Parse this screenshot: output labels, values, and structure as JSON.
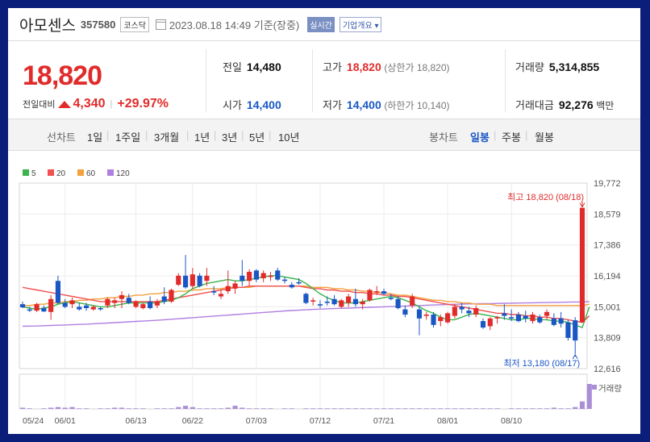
{
  "header": {
    "name": "아모센스",
    "code": "357580",
    "market": "코스닥",
    "datetime": "2023.08.18 14:49 기준(장중)",
    "realtime": "실시간",
    "overview": "기업개요"
  },
  "quote": {
    "price": "18,820",
    "change_label": "전일대비",
    "change": "4,340",
    "change_pct": "+29.97%",
    "prev_label": "전일",
    "prev": "14,480",
    "high_label": "고가",
    "high": "18,820",
    "upper_label": "(상한가 18,820)",
    "volume_label": "거래량",
    "volume": "5,314,855",
    "open_label": "시가",
    "open": "14,400",
    "low_label": "저가",
    "low": "14,400",
    "lower_label": "(하한가 10,140)",
    "amount_label": "거래대금",
    "amount": "92,276",
    "amount_unit": "백만"
  },
  "tabs": {
    "line_label": "선차트",
    "line": [
      "1일",
      "1주일",
      "3개월",
      "1년",
      "3년",
      "5년",
      "10년"
    ],
    "candle_label": "봉차트",
    "candle": [
      "일봉",
      "주봉",
      "월봉"
    ],
    "candle_selected": "일봉"
  },
  "colors": {
    "up": "#e12b2b",
    "down": "#1a57c4",
    "ma5": "#3cb44b",
    "ma20": "#f0504f",
    "ma60": "#f4a03c",
    "ma120": "#b07fe0",
    "volume": "#a98fd6"
  },
  "chart_data": {
    "type": "candlestick",
    "legend": [
      "5",
      "20",
      "60",
      "120"
    ],
    "y_ticks": [
      "19,772",
      "18,579",
      "17,386",
      "16,194",
      "15,001",
      "13,809",
      "12,616"
    ],
    "ylim": [
      12616,
      19772
    ],
    "x_ticks": [
      "05/24",
      "06/01",
      "06/13",
      "06/22",
      "07/03",
      "07/12",
      "07/21",
      "08/01",
      "08/10"
    ],
    "max_label": "최고 18,820 (08/18)",
    "min_label": "최저 13,180 (08/17)",
    "volume_label": "거래량",
    "candles": [
      [
        15100,
        15200,
        14950,
        14980
      ],
      [
        14900,
        15000,
        14800,
        14850
      ],
      [
        14850,
        15150,
        14800,
        15100
      ],
      [
        14950,
        15050,
        14800,
        14820
      ],
      [
        14800,
        15450,
        14500,
        15300
      ],
      [
        16000,
        16200,
        15100,
        15150
      ],
      [
        15150,
        15300,
        14950,
        15000
      ],
      [
        15100,
        15350,
        14950,
        15250
      ],
      [
        15000,
        15150,
        14850,
        14900
      ],
      [
        15050,
        15150,
        14850,
        14950
      ],
      [
        14900,
        15050,
        14850,
        15000
      ],
      [
        14950,
        15000,
        14850,
        14900
      ],
      [
        15050,
        15350,
        14950,
        15300
      ],
      [
        15150,
        15350,
        14950,
        15250
      ],
      [
        15300,
        15600,
        14950,
        15450
      ],
      [
        15350,
        15500,
        15100,
        15150
      ],
      [
        15000,
        15250,
        14950,
        15200
      ],
      [
        14950,
        15150,
        14900,
        15100
      ],
      [
        15200,
        15400,
        14900,
        14950
      ],
      [
        15050,
        15300,
        14950,
        15200
      ],
      [
        15400,
        15750,
        15100,
        15200
      ],
      [
        15200,
        15700,
        15150,
        15650
      ],
      [
        15850,
        16300,
        15800,
        16200
      ],
      [
        16200,
        17000,
        15700,
        15750
      ],
      [
        15800,
        16500,
        15700,
        16250
      ],
      [
        16200,
        16300,
        15750,
        15800
      ],
      [
        16000,
        16500,
        15800,
        16200
      ],
      [
        15600,
        15800,
        15450,
        15550
      ],
      [
        15400,
        15650,
        15300,
        15500
      ],
      [
        15600,
        16400,
        15500,
        15800
      ],
      [
        15700,
        16000,
        15500,
        15900
      ],
      [
        16200,
        16800,
        15800,
        16000
      ],
      [
        16000,
        16450,
        15800,
        16350
      ],
      [
        16400,
        16450,
        15950,
        16050
      ],
      [
        16100,
        16400,
        15950,
        16300
      ],
      [
        16150,
        16350,
        16000,
        16200
      ],
      [
        16400,
        16500,
        16000,
        16050
      ],
      [
        16050,
        16150,
        15900,
        16000
      ],
      [
        15850,
        15950,
        15700,
        15750
      ],
      [
        15950,
        16100,
        15850,
        15900
      ],
      [
        15500,
        15550,
        15100,
        15150
      ],
      [
        15200,
        15350,
        15050,
        15250
      ],
      [
        15100,
        15250,
        14950,
        15050
      ],
      [
        15200,
        15400,
        15050,
        15150
      ],
      [
        15300,
        15450,
        15050,
        15100
      ],
      [
        15000,
        15300,
        14950,
        15250
      ],
      [
        15150,
        15500,
        15000,
        15400
      ],
      [
        15300,
        15700,
        15000,
        15100
      ],
      [
        15100,
        15300,
        14900,
        15200
      ],
      [
        15250,
        15700,
        15200,
        15650
      ],
      [
        15550,
        15800,
        15450,
        15600
      ],
      [
        15600,
        15700,
        15450,
        15500
      ],
      [
        15350,
        15500,
        15250,
        15300
      ],
      [
        15300,
        15400,
        14900,
        14950
      ],
      [
        14900,
        15050,
        14600,
        14700
      ],
      [
        15050,
        15500,
        14950,
        15400
      ],
      [
        14900,
        15000,
        13900,
        14550
      ],
      [
        14650,
        14800,
        14500,
        14700
      ],
      [
        14700,
        14800,
        14200,
        14300
      ],
      [
        14450,
        14700,
        14250,
        14600
      ],
      [
        14400,
        14800,
        14350,
        14750
      ],
      [
        14650,
        15100,
        14550,
        15000
      ],
      [
        15000,
        15150,
        14750,
        14900
      ],
      [
        14850,
        15000,
        14600,
        14750
      ],
      [
        14700,
        15050,
        14600,
        14950
      ],
      [
        14450,
        14550,
        14150,
        14200
      ],
      [
        14250,
        14600,
        14100,
        14550
      ],
      [
        14550,
        14650,
        14350,
        14600
      ],
      [
        14750,
        15100,
        14500,
        14650
      ],
      [
        14600,
        14900,
        14450,
        14550
      ],
      [
        14700,
        14800,
        14400,
        14450
      ],
      [
        14650,
        14850,
        14400,
        14550
      ],
      [
        14450,
        14800,
        14350,
        14700
      ],
      [
        14600,
        14700,
        14350,
        14400
      ],
      [
        14650,
        14900,
        14500,
        14800
      ],
      [
        14550,
        14750,
        14250,
        14300
      ],
      [
        14550,
        14800,
        14200,
        14350
      ],
      [
        14400,
        14500,
        13700,
        13800
      ],
      [
        14480,
        14600,
        13180,
        13700
      ],
      [
        14400,
        18820,
        14400,
        18820
      ]
    ],
    "volume": [
      2,
      1,
      0,
      1,
      2,
      3,
      2,
      3,
      1,
      1,
      0,
      1,
      1,
      2,
      2,
      1,
      1,
      1,
      0,
      1,
      1,
      1,
      3,
      5,
      3,
      1,
      1,
      1,
      1,
      2,
      5,
      2,
      1,
      1,
      1,
      1,
      0,
      1,
      1,
      0,
      1,
      1,
      1,
      1,
      1,
      1,
      1,
      1,
      1,
      1,
      1,
      1,
      1,
      1,
      1,
      1,
      1,
      1,
      1,
      1,
      1,
      1,
      1,
      1,
      1,
      1,
      1,
      1,
      0,
      1,
      1,
      1,
      1,
      1,
      1,
      2,
      1,
      1,
      3,
      12,
      40
    ],
    "ma5": [
      15000,
      14950,
      14900,
      14950,
      15000,
      15100,
      15150,
      15200,
      15150,
      15100,
      15050,
      15000,
      15000,
      15050,
      15100,
      15150,
      15150,
      15150,
      15150,
      15150,
      15200,
      15250,
      15350,
      15500,
      15700,
      15800,
      15900,
      15950,
      16000,
      16050,
      16000,
      16000,
      16050,
      16100,
      16150,
      16200,
      16200,
      16150,
      16100,
      16050,
      15900,
      15700,
      15500,
      15350,
      15250,
      15150,
      15150,
      15150,
      15200,
      15250,
      15300,
      15350,
      15400,
      15350,
      15250,
      15150,
      15000,
      14850,
      14750,
      14600,
      14500,
      14500,
      14600,
      14700,
      14750,
      14700,
      14650,
      14600,
      14550,
      14500,
      14500,
      14550,
      14550,
      14500,
      14500,
      14450,
      14450,
      14400,
      14300,
      14200,
      15000
    ],
    "ma20": [
      15750,
      15700,
      15650,
      15600,
      15550,
      15500,
      15450,
      15400,
      15350,
      15300,
      15250,
      15200,
      15200,
      15200,
      15200,
      15200,
      15200,
      15200,
      15200,
      15200,
      15250,
      15300,
      15350,
      15400,
      15450,
      15500,
      15550,
      15600,
      15650,
      15700,
      15750,
      15750,
      15800,
      15800,
      15800,
      15800,
      15800,
      15800,
      15800,
      15800,
      15750,
      15700,
      15700,
      15650,
      15650,
      15600,
      15600,
      15550,
      15550,
      15500,
      15500,
      15450,
      15450,
      15400,
      15400,
      15350,
      15300,
      15250,
      15200,
      15150,
      15100,
      15050,
      15000,
      14950,
      14900,
      14850,
      14800,
      14750,
      14750,
      14700,
      14700,
      14650,
      14650,
      14600,
      14600,
      14550,
      14550,
      14500,
      14450,
      14400,
      14650
    ],
    "ma60": [
      15050,
      15050,
      15100,
      15100,
      15150,
      15150,
      15200,
      15200,
      15250,
      15250,
      15300,
      15300,
      15350,
      15350,
      15400,
      15400,
      15450,
      15450,
      15500,
      15500,
      15550,
      15550,
      15600,
      15600,
      15650,
      15650,
      15700,
      15700,
      15700,
      15750,
      15750,
      15750,
      15750,
      15800,
      15800,
      15800,
      15800,
      15800,
      15800,
      15800,
      15800,
      15750,
      15750,
      15750,
      15700,
      15700,
      15650,
      15650,
      15600,
      15600,
      15550,
      15550,
      15500,
      15450,
      15450,
      15400,
      15350,
      15300,
      15250,
      15250,
      15200,
      15200,
      15150,
      15150,
      15100,
      15100,
      15100,
      15050,
      15050,
      15050,
      15050,
      15050,
      15050,
      15050,
      15050,
      15050,
      15050,
      15050,
      15050,
      15050,
      15100
    ],
    "ma120": [
      14250,
      14255,
      14260,
      14270,
      14280,
      14290,
      14300,
      14310,
      14320,
      14330,
      14345,
      14360,
      14375,
      14390,
      14405,
      14420,
      14435,
      14450,
      14465,
      14480,
      14500,
      14520,
      14540,
      14560,
      14580,
      14600,
      14620,
      14640,
      14660,
      14680,
      14700,
      14720,
      14740,
      14760,
      14780,
      14800,
      14820,
      14840,
      14855,
      14870,
      14885,
      14900,
      14910,
      14920,
      14930,
      14940,
      14950,
      14960,
      14970,
      14980,
      14990,
      15000,
      15010,
      15020,
      15030,
      15040,
      15050,
      15060,
      15070,
      15080,
      15090,
      15100,
      15105,
      15110,
      15115,
      15120,
      15125,
      15130,
      15135,
      15140,
      15145,
      15150,
      15155,
      15160,
      15165,
      15170,
      15175,
      15180,
      15185,
      15190,
      15200
    ]
  }
}
